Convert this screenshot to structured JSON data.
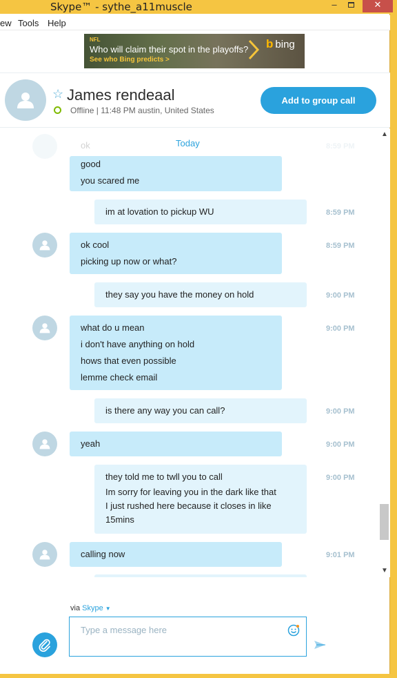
{
  "window": {
    "title": "Skype™ - sythe_a11muscle",
    "minimize": "–",
    "close": "✕"
  },
  "menu": {
    "items": [
      "ew",
      "Tools",
      "Help"
    ]
  },
  "ad": {
    "tag": "NFL",
    "headline": "Who will claim their spot in the playoffs?",
    "link": "See who Bing predicts >",
    "brand": "bing"
  },
  "contact": {
    "name": "James rendeaal",
    "status": "Offline | 11:48 PM austin, United States",
    "add_group_label": "Add to group call"
  },
  "conversation": {
    "date_label": "Today",
    "faded_top_text": "ok",
    "faded_top_time": "8:59 PM",
    "messages": [
      {
        "dir": "in",
        "lines": [
          "good",
          "you scared me"
        ],
        "time": ""
      },
      {
        "dir": "out",
        "lines": [
          "im at lovation to pickup WU"
        ],
        "time": "8:59 PM"
      },
      {
        "dir": "in",
        "lines": [
          "ok cool",
          "picking up now or what?"
        ],
        "time": "8:59 PM"
      },
      {
        "dir": "out",
        "lines": [
          "they say you have the money on hold"
        ],
        "time": "9:00 PM"
      },
      {
        "dir": "in",
        "lines": [
          "what do u mean",
          "i don't have anything on hold",
          "hows that even possible",
          "lemme check email"
        ],
        "time": "9:00 PM"
      },
      {
        "dir": "out",
        "lines": [
          "is there any way you can call?"
        ],
        "time": "9:00 PM"
      },
      {
        "dir": "in",
        "lines": [
          "yeah"
        ],
        "time": "9:00 PM"
      },
      {
        "dir": "out",
        "lines": [
          "they told me to twll you to call",
          "Im sorry for leaving you in the dark like that",
          "I just rushed here because it closes in like",
          "15mins"
        ],
        "time": "9:00 PM"
      },
      {
        "dir": "in",
        "lines": [
          "calling now"
        ],
        "time": "9:01 PM"
      }
    ]
  },
  "compose": {
    "via_label": "via",
    "via_service": "Skype",
    "placeholder": "Type a message here"
  },
  "colors": {
    "accent": "#2aa2dd",
    "incoming_bubble": "#c7ebfa",
    "outgoing_bubble": "#e2f4fc",
    "presence_offline": "#7fba00",
    "frame": "#f5c542"
  }
}
